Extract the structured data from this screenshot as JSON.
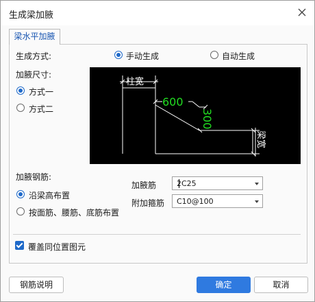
{
  "window": {
    "title": "生成梁加腋"
  },
  "tab": {
    "label": "梁水平加腋"
  },
  "generation": {
    "label": "生成方式:",
    "options": [
      {
        "label": "手动生成",
        "selected": true
      },
      {
        "label": "自动生成",
        "selected": false
      }
    ]
  },
  "size": {
    "label": "加腋尺寸:",
    "options": [
      {
        "label": "方式一",
        "selected": true
      },
      {
        "label": "方式二",
        "selected": false
      }
    ]
  },
  "diagram": {
    "column_width_label": "柱宽",
    "dim_600": "600",
    "dim_300": "300",
    "beam_width_label": "梁宽",
    "line_color": "#ffffff",
    "dim_color": "#22dd22"
  },
  "rebar": {
    "label": "加腋钢筋:",
    "options": [
      {
        "label": "沿梁高布置",
        "selected": true
      },
      {
        "label": "按面筋、腰筋、底筋布置",
        "selected": false
      }
    ],
    "haunch_bar_label": "加腋筋",
    "haunch_bar_value": "2C25",
    "extra_stirrup_label": "附加箍筋",
    "extra_stirrup_value": "C10@100"
  },
  "overwrite": {
    "label": "覆盖同位置图元",
    "checked": true
  },
  "buttons": {
    "rebar_help": "钢筋说明",
    "ok": "确定",
    "cancel": "取消"
  },
  "colors": {
    "accent": "#1e69c9",
    "primary_button": "#2f7ae0"
  }
}
